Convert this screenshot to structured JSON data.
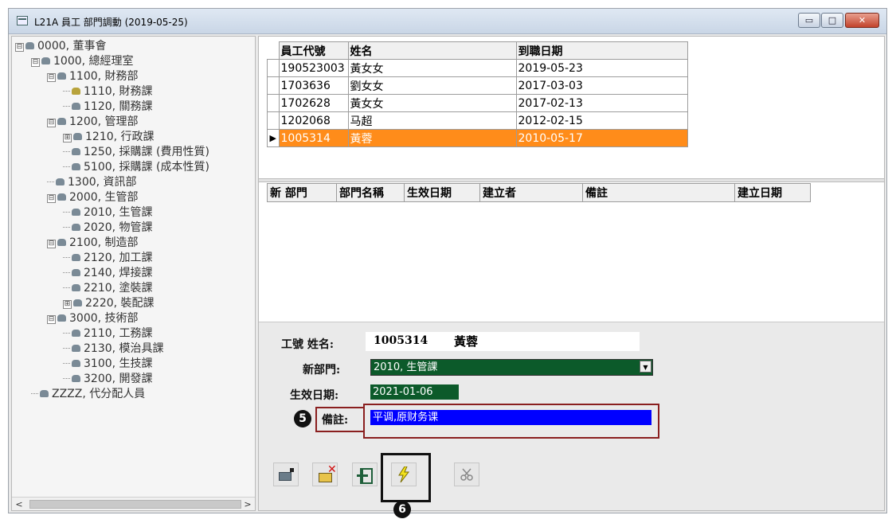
{
  "window": {
    "title": "L21A 員工 部門調動 (2019-05-25)",
    "buttons": {
      "minimize": "▭",
      "maximize": "□",
      "close": "✕"
    }
  },
  "tree": {
    "nodes": [
      {
        "label": "0000, 董事會",
        "expander": "⊟"
      },
      {
        "label": "1000, 總經理室",
        "expander": "⊟"
      },
      {
        "label": "1100, 財務部",
        "expander": "⊟"
      },
      {
        "label": "1110, 財務課",
        "expander": ""
      },
      {
        "label": "1120, 關務課",
        "expander": ""
      },
      {
        "label": "1200, 管理部",
        "expander": "⊟"
      },
      {
        "label": "1210, 行政課",
        "expander": "⊞"
      },
      {
        "label": "1250, 採購課 (費用性質)",
        "expander": ""
      },
      {
        "label": "5100, 採購課 (成本性質)",
        "expander": ""
      },
      {
        "label": "1300, 資訊部",
        "expander": ""
      },
      {
        "label": "2000, 生管部",
        "expander": "⊟"
      },
      {
        "label": "2010, 生管課",
        "expander": ""
      },
      {
        "label": "2020, 物管課",
        "expander": ""
      },
      {
        "label": "2100, 制造部",
        "expander": "⊟"
      },
      {
        "label": "2120, 加工課",
        "expander": ""
      },
      {
        "label": "2140, 焊接課",
        "expander": ""
      },
      {
        "label": "2210, 塗裝課",
        "expander": ""
      },
      {
        "label": "2220, 裝配課",
        "expander": "⊞"
      },
      {
        "label": "3000, 技術部",
        "expander": "⊟"
      },
      {
        "label": "2110, 工務課",
        "expander": ""
      },
      {
        "label": "2130, 模治具課",
        "expander": ""
      },
      {
        "label": "3100, 生技課",
        "expander": ""
      },
      {
        "label": "3200, 開發課",
        "expander": ""
      },
      {
        "label": "ZZZZ, 代分配人員",
        "expander": ""
      }
    ],
    "scroll_left": "<",
    "scroll_right": ">"
  },
  "employee_table": {
    "headers": [
      "員工代號",
      "姓名",
      "到職日期"
    ],
    "rows": [
      [
        "190523003",
        "黃女女",
        "2019-05-23"
      ],
      [
        "1703636",
        "劉女女",
        "2017-03-03"
      ],
      [
        "1702628",
        "黃女女",
        "2017-02-13"
      ],
      [
        "1202068",
        "马超",
        "2012-02-15"
      ],
      [
        "1005314",
        "黃蓉",
        "2010-05-17"
      ]
    ],
    "selected_marker": "▶",
    "selected_color": "#ff8c1a"
  },
  "dept_table": {
    "headers": [
      "新 部門",
      "部門名稱",
      "生效日期",
      "建立者",
      "備註",
      "建立日期"
    ]
  },
  "form": {
    "emp_label": "工號 姓名:",
    "emp_id": "1005314",
    "emp_name": "黃蓉",
    "new_dept_label": "新部門:",
    "new_dept_value": "2010, 生管課",
    "effective_date_label": "生效日期:",
    "effective_date_value": "2021-01-06",
    "remark_label": "備註:",
    "remark_value": "平调,原财务课",
    "field_color": "#0c5a2a",
    "remark_color": "#0000ff",
    "dropdown_arrow": "▼"
  },
  "markers": {
    "step5": "5",
    "step6": "6"
  },
  "toolbar": {
    "icons": [
      "add-record-icon",
      "delete-record-icon",
      "exit-icon",
      "execute-icon",
      "cut-icon"
    ]
  }
}
